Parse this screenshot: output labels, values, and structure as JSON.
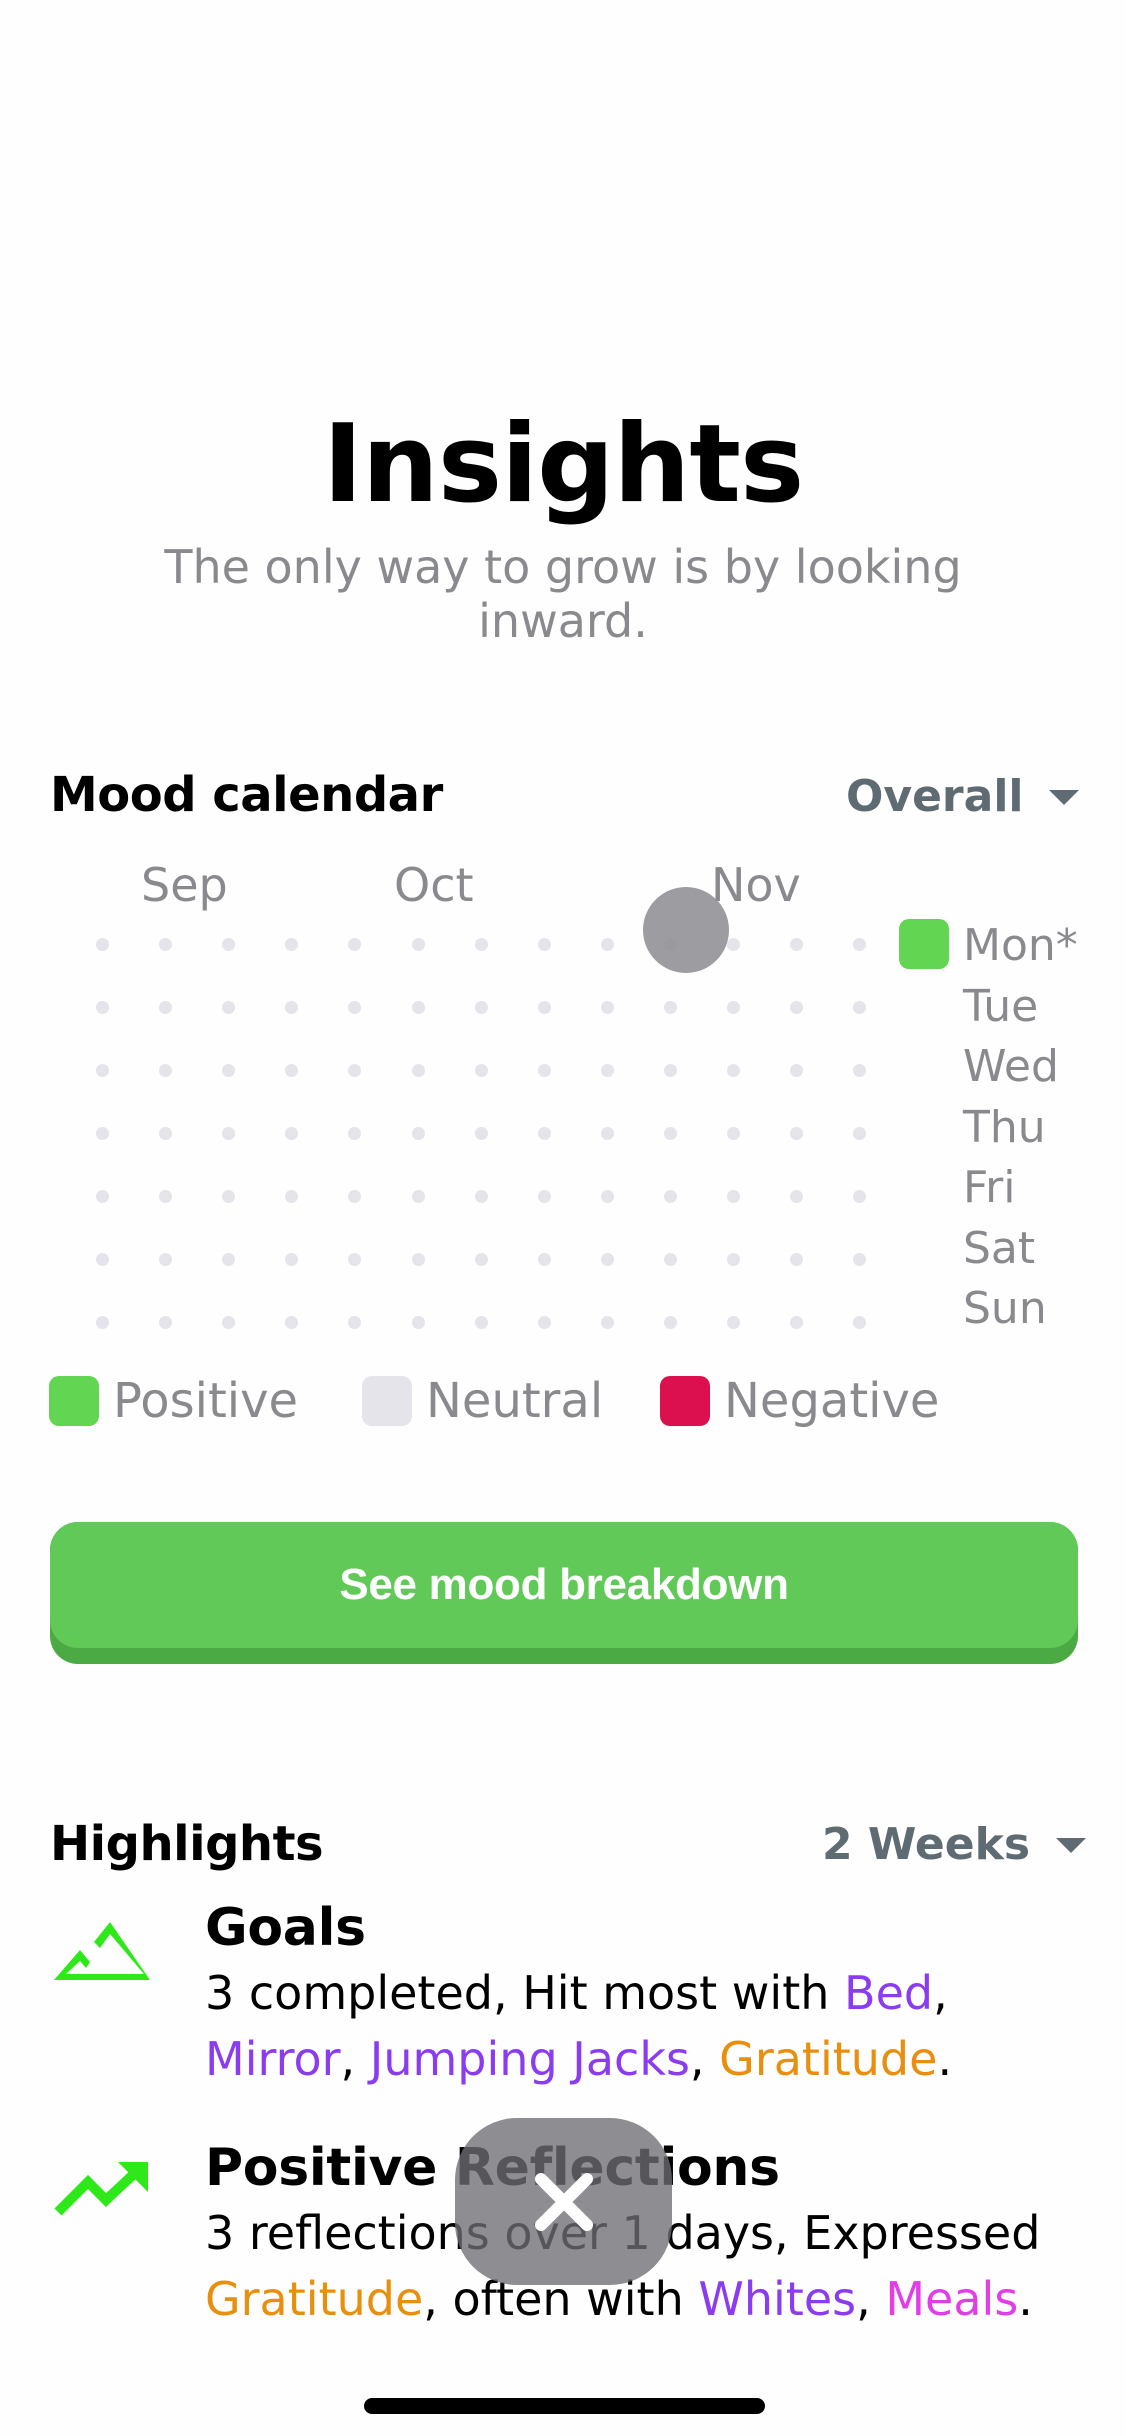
{
  "header": {
    "title": "Insights",
    "subtitle": "The only way to grow is by looking inward."
  },
  "mood_calendar": {
    "title": "Mood calendar",
    "filter": {
      "selected": "Overall",
      "icon": "caret-down-icon"
    },
    "months": [
      "Sep",
      "Oct",
      "Nov"
    ],
    "days": [
      "Mon*",
      "Tue",
      "Wed",
      "Thu",
      "Fri",
      "Sat",
      "Sun"
    ],
    "weeks_shown": 13,
    "entries": [
      {
        "day": "Mon*",
        "mood": "Positive",
        "week": "current"
      }
    ],
    "legend": [
      {
        "label": "Positive",
        "color": "#62d552"
      },
      {
        "label": "Neutral",
        "color": "#e4e4ea"
      },
      {
        "label": "Negative",
        "color": "#dc104f"
      }
    ],
    "empty_dot_color": "#e4e4ea"
  },
  "cta": {
    "label": "See mood breakdown",
    "color": "#60c957"
  },
  "highlights": {
    "title": "Highlights",
    "filter": {
      "selected": "2 Weeks",
      "icon": "caret-down-icon"
    },
    "items": [
      {
        "icon": "mountain-icon",
        "title": "Goals",
        "body": [
          {
            "text": "3 completed, Hit most with ",
            "style": "plain"
          },
          {
            "text": "Bed",
            "style": "purple"
          },
          {
            "text": ", ",
            "style": "plain"
          },
          {
            "text": "Mirror",
            "style": "purple"
          },
          {
            "text": ", ",
            "style": "plain"
          },
          {
            "text": "Jumping Jacks",
            "style": "purple"
          },
          {
            "text": ", ",
            "style": "plain"
          },
          {
            "text": "Gratitude",
            "style": "orange"
          },
          {
            "text": ".",
            "style": "plain"
          }
        ]
      },
      {
        "icon": "trending-up-icon",
        "title": "Positive Reflections",
        "body": [
          {
            "text": "3 reflections over 1 days, Expressed ",
            "style": "plain"
          },
          {
            "text": "Gratitude",
            "style": "orange"
          },
          {
            "text": ", often with ",
            "style": "plain"
          },
          {
            "text": "Whites",
            "style": "purple"
          },
          {
            "text": ", ",
            "style": "plain"
          },
          {
            "text": "Meals",
            "style": "pink"
          },
          {
            "text": ".",
            "style": "plain"
          }
        ]
      }
    ]
  },
  "overlay": {
    "close_icon": "close-icon"
  },
  "colors": {
    "accent_green": "#60c957",
    "icon_green": "#2ee81a",
    "tag_purple": "#8b3cf0",
    "tag_orange": "#e8900e",
    "tag_pink": "#e23ee8"
  }
}
